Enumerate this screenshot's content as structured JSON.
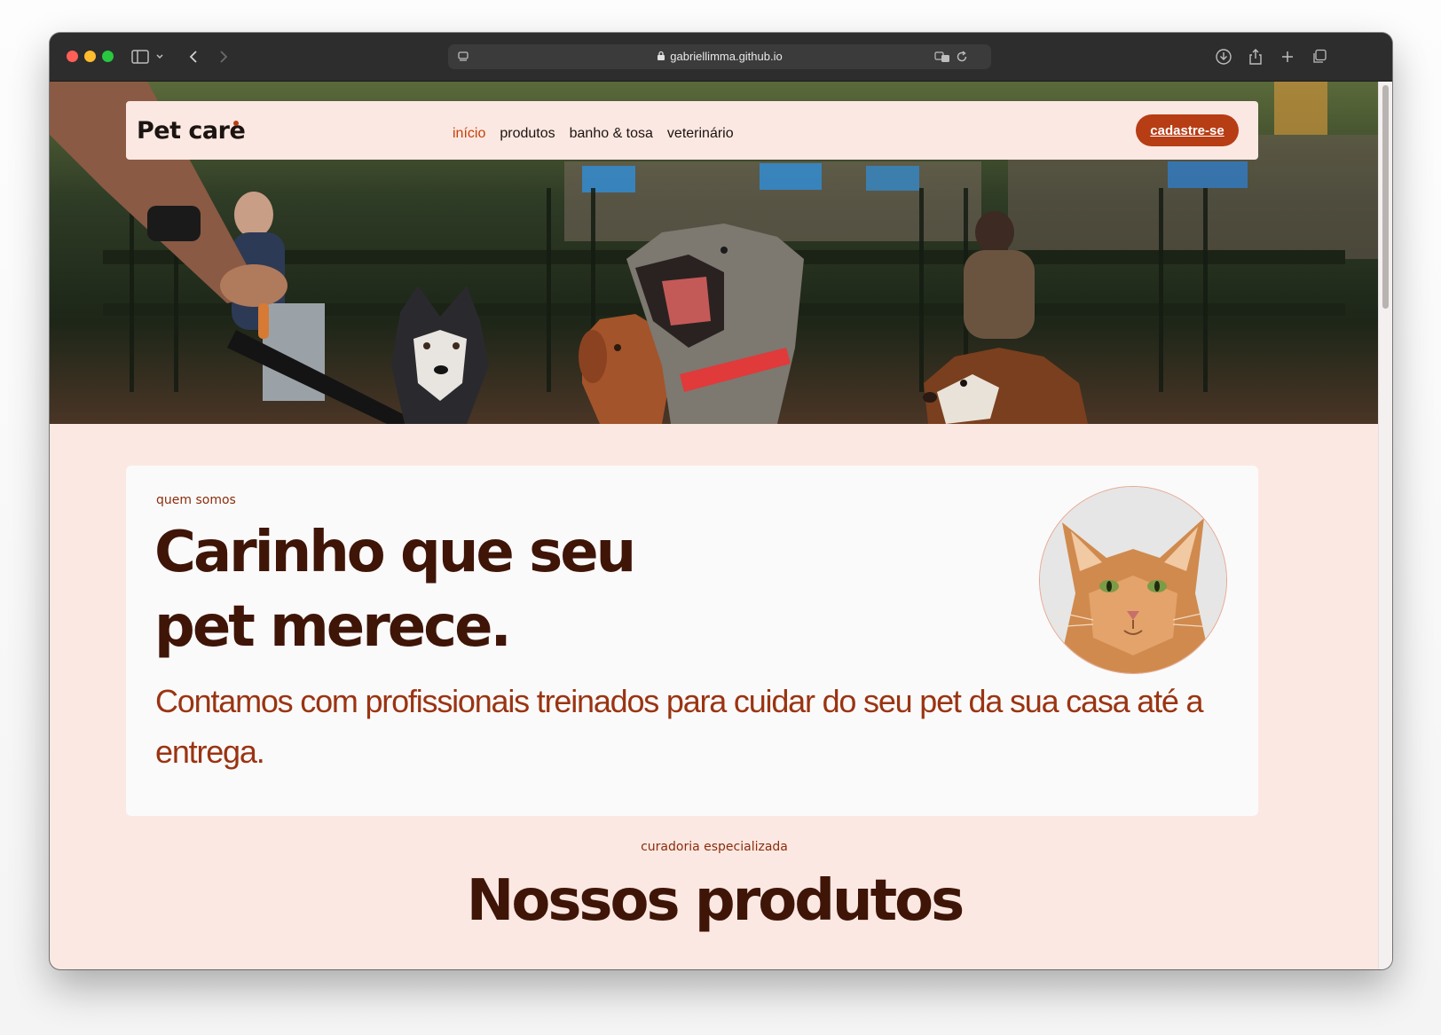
{
  "browser": {
    "url": "gabriellimma.github.io",
    "icons": [
      "sidebar-icon",
      "chevron-down-icon",
      "back-icon",
      "forward-icon",
      "site-settings-icon",
      "lock-icon",
      "translate-icon",
      "reload-icon",
      "download-icon",
      "share-icon",
      "new-tab-icon",
      "tab-overview-icon"
    ]
  },
  "header": {
    "logo": "Pet care",
    "nav": [
      {
        "label": "início",
        "active": true
      },
      {
        "label": "produtos",
        "active": false
      },
      {
        "label": "banho & tosa",
        "active": false
      },
      {
        "label": "veterinário",
        "active": false
      }
    ],
    "cta": "cadastre-se"
  },
  "about": {
    "eyebrow": "quem somos",
    "headline_line1": "Carinho que seu",
    "headline_line2": "pet merece.",
    "lead": "Contamos com profissionais treinados para cuidar do seu pet da sua casa até a entrega."
  },
  "products": {
    "eyebrow": "curadoria especializada",
    "title": "Nossos produtos"
  },
  "colors": {
    "page_background": "#fce8e2",
    "accent": "#b73d15",
    "heading": "#3f1508",
    "lead_text": "#9a3412"
  }
}
